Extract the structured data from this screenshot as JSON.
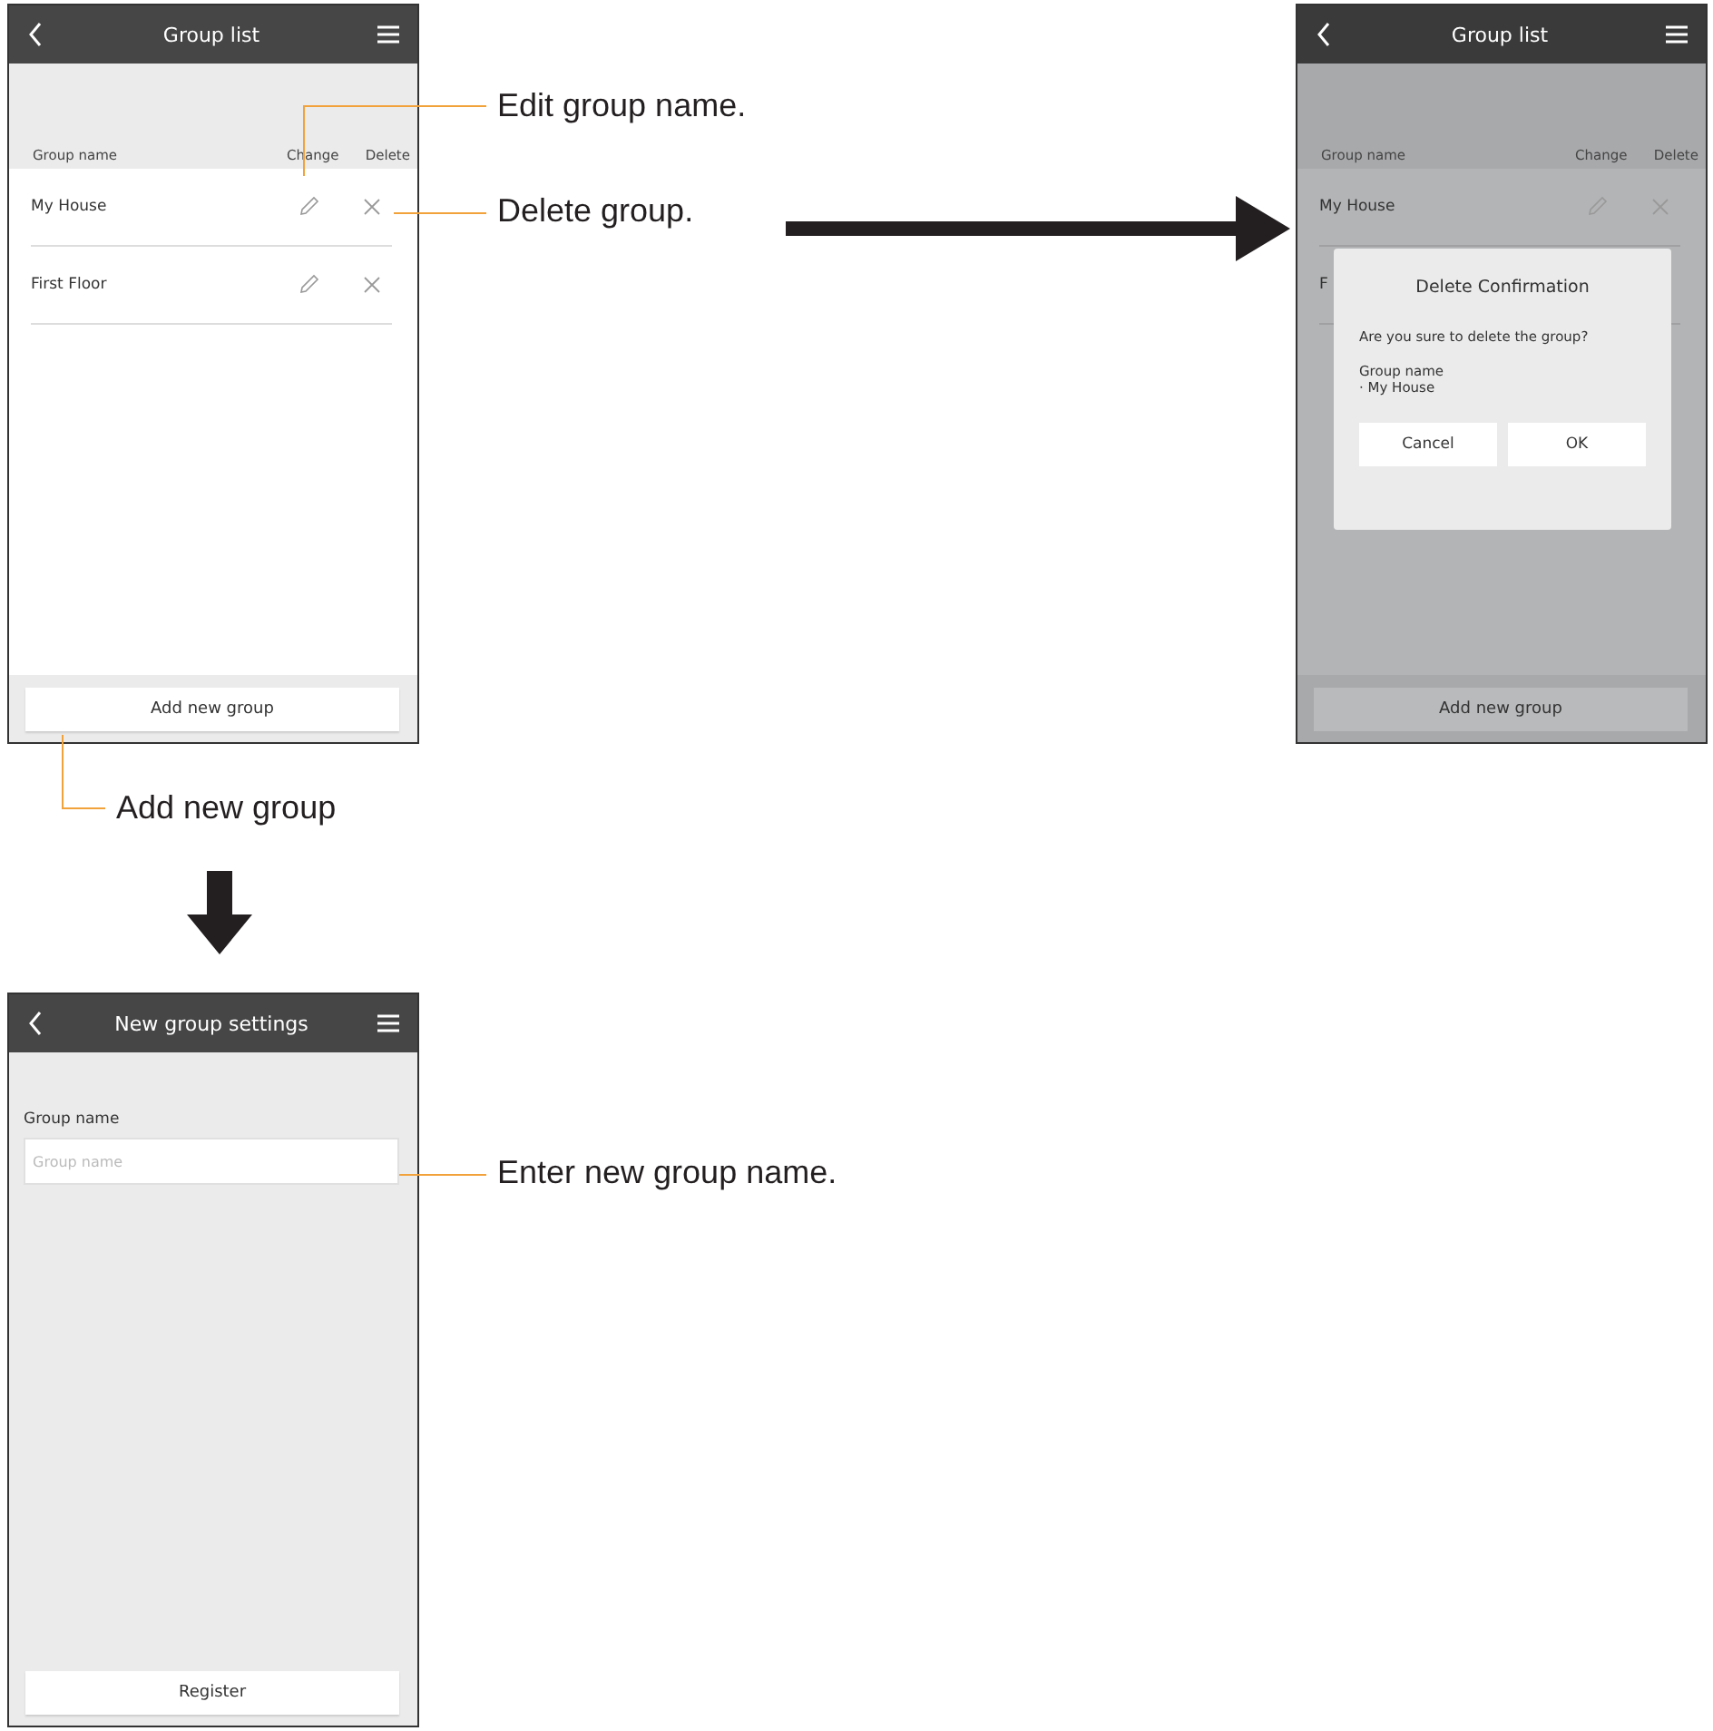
{
  "screens": [
    {
      "kind": "list",
      "title": "Group list",
      "columns": [
        "Group name",
        "Change",
        "Delete"
      ],
      "groups": [
        "My House",
        "First Floor"
      ],
      "footer_button": "Add new group"
    },
    {
      "kind": "list",
      "title": "Group list",
      "columns": [
        "Group name",
        "Change",
        "Delete"
      ],
      "groups": [
        "My House",
        "F"
      ],
      "footer_button": "Add new group",
      "dialog": {
        "title": "Delete Confirmation",
        "message": "Are you sure to delete the group?",
        "label": "Group name",
        "item": "· My House",
        "buttons": [
          "Cancel",
          "OK"
        ]
      }
    },
    {
      "kind": "form",
      "title": "New group settings",
      "field_label": "Group name",
      "placeholder": "Group name",
      "footer_button": "Register"
    }
  ],
  "callouts": [
    {
      "text": "Edit group name."
    },
    {
      "text": "Delete group."
    },
    {
      "text": "Add new group"
    },
    {
      "text": "Enter new group name."
    }
  ]
}
